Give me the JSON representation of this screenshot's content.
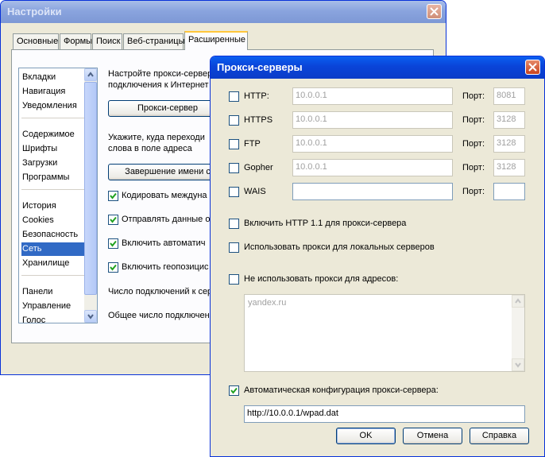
{
  "settings_window": {
    "title": "Настройки",
    "tabs": [
      "Основные",
      "Формы",
      "Поиск",
      "Веб-страницы",
      "Расширенные"
    ],
    "active_tab": "Расширенные",
    "sidebar": {
      "groups": [
        [
          "Вкладки",
          "Навигация",
          "Уведомления"
        ],
        [
          "Содержимое",
          "Шрифты",
          "Загрузки",
          "Программы"
        ],
        [
          "История",
          "Cookies",
          "Безопасность",
          "Сеть",
          "Хранилище"
        ],
        [
          "Панели",
          "Управление",
          "Голос"
        ]
      ],
      "selected": "Сеть"
    },
    "proxy_text_1": "Настройте прокси-сервер",
    "proxy_text_2": "подключения к Интернет",
    "proxy_button": "Прокси-сервер",
    "address_text_1": "Укажите, куда переходи",
    "address_text_2": "слова в поле адреса",
    "completion_button": "Завершение имени с",
    "checkboxes": [
      {
        "label": "Кодировать междуна",
        "checked": true
      },
      {
        "label": "Отправлять данные о",
        "checked": true
      },
      {
        "label": "Включить автоматич",
        "checked": true
      },
      {
        "label": "Включить геопозицис",
        "checked": true
      }
    ],
    "connections_text": "Число подключений к сер",
    "total_connections_text": "Общее число подключен"
  },
  "proxy_dialog": {
    "title": "Прокси-серверы",
    "port_label": "Порт:",
    "protocols": [
      {
        "name": "HTTP:",
        "address": "10.0.0.1",
        "port": "8081",
        "checked": false,
        "disabled": true
      },
      {
        "name": "HTTPS",
        "address": "10.0.0.1",
        "port": "3128",
        "checked": false,
        "disabled": true
      },
      {
        "name": "FTP",
        "address": "10.0.0.1",
        "port": "3128",
        "checked": false,
        "disabled": true
      },
      {
        "name": "Gopher",
        "address": "10.0.0.1",
        "port": "3128",
        "checked": false,
        "disabled": true
      },
      {
        "name": "WAIS",
        "address": "",
        "port": "",
        "checked": false,
        "disabled": false
      }
    ],
    "http11_label": "Включить HTTP 1.1 для прокси-сервера",
    "local_label": "Использовать прокси для локальных серверов",
    "exclude_label": "Не использовать прокси для адресов:",
    "exclude_text": "yandex.ru",
    "auto_config_label": "Автоматическая конфигурация прокси-сервера:",
    "auto_config_checked": true,
    "auto_config_url": "http://10.0.0.1/wpad.dat",
    "ok_button": "OK",
    "cancel_button": "Отмена",
    "help_button": "Справка"
  }
}
